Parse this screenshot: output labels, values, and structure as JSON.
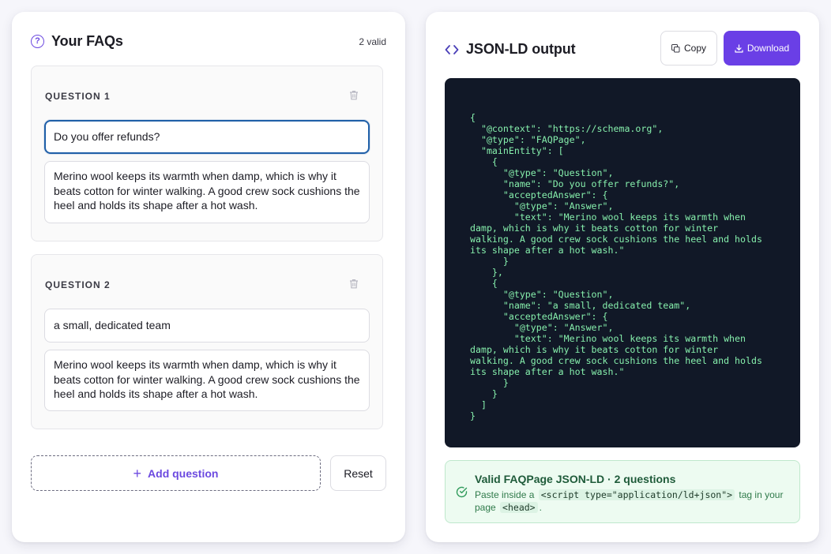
{
  "left": {
    "title": "Your FAQs",
    "valid_count": "2 valid",
    "questions": [
      {
        "label": "QUESTION 1",
        "question": "Do you offer refunds?",
        "answer": "Merino wool keeps its warmth when damp, which is why it beats cotton for winter walking. A good crew sock cushions the heel and holds its shape after a hot wash."
      },
      {
        "label": "QUESTION 2",
        "question": "a small, dedicated team",
        "answer": "Merino wool keeps its warmth when damp, which is why it beats cotton for winter walking. A good crew sock cushions the heel and holds its shape after a hot wash."
      }
    ],
    "add_label": "Add question",
    "reset_label": "Reset"
  },
  "right": {
    "title": "JSON-LD output",
    "copy_label": "Copy",
    "download_label": "Download",
    "code": "{\n  \"@context\": \"https://schema.org\",\n  \"@type\": \"FAQPage\",\n  \"mainEntity\": [\n    {\n      \"@type\": \"Question\",\n      \"name\": \"Do you offer refunds?\",\n      \"acceptedAnswer\": {\n        \"@type\": \"Answer\",\n        \"text\": \"Merino wool keeps its warmth when\ndamp, which is why it beats cotton for winter\nwalking. A good crew sock cushions the heel and holds\nits shape after a hot wash.\"\n      }\n    },\n    {\n      \"@type\": \"Question\",\n      \"name\": \"a small, dedicated team\",\n      \"acceptedAnswer\": {\n        \"@type\": \"Answer\",\n        \"text\": \"Merino wool keeps its warmth when\ndamp, which is why it beats cotton for winter\nwalking. A good crew sock cushions the heel and holds\nits shape after a hot wash.\"\n      }\n    }\n  ]\n}",
    "valid_title": "Valid FAQPage JSON-LD · 2 questions",
    "valid_desc_pre": "Paste inside a",
    "valid_desc_code1": "<script type=\"application/ld+json\">",
    "valid_desc_mid": "tag in your page",
    "valid_desc_code2": "<head>",
    "valid_desc_post": "."
  },
  "colors": {
    "accent": "#6a3fe6",
    "code_bg": "#111827",
    "code_text": "#86efac",
    "success_bg": "#edfbf1"
  },
  "icons": {
    "help": "question-circle-icon",
    "code": "code-brackets-icon",
    "trash": "trash-icon",
    "copy": "copy-icon",
    "download": "download-icon",
    "check": "check-circle-icon"
  }
}
